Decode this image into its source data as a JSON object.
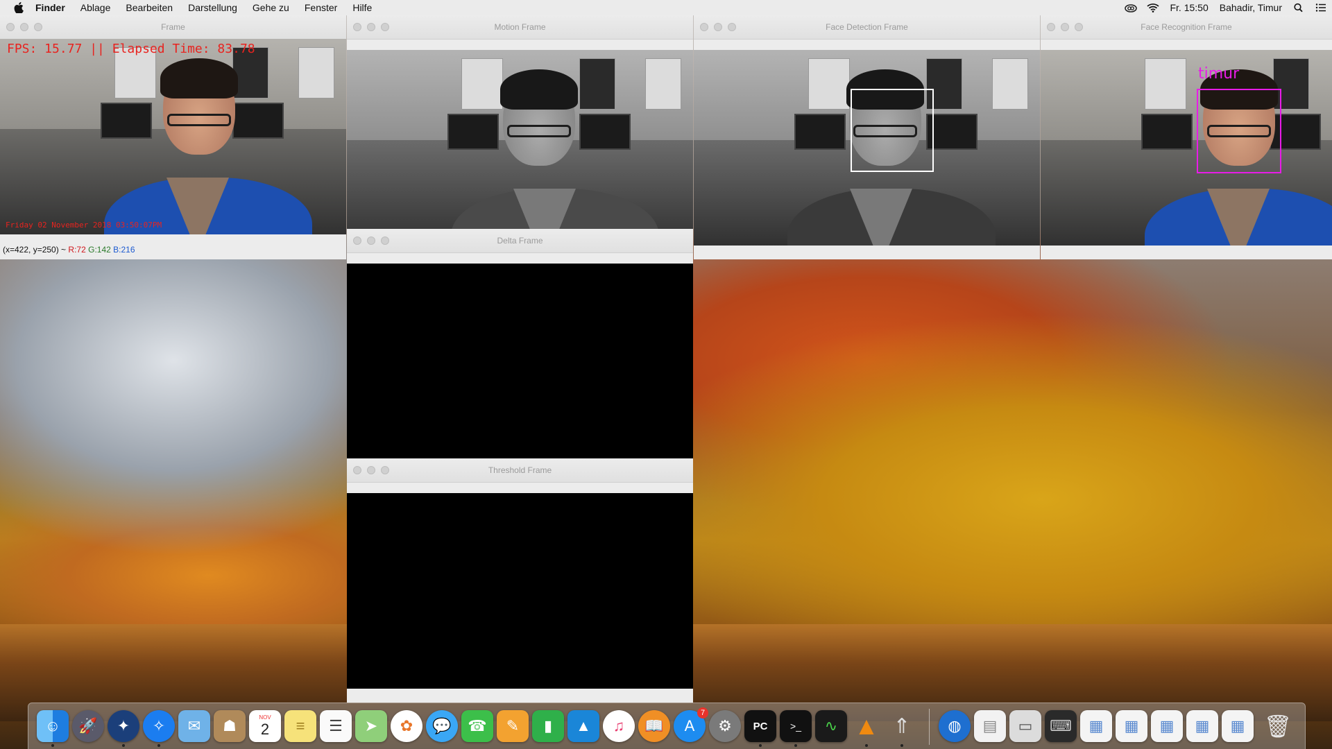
{
  "menubar": {
    "app": "Finder",
    "items": [
      "Ablage",
      "Bearbeiten",
      "Darstellung",
      "Gehe zu",
      "Fenster",
      "Hilfe"
    ],
    "clock": "Fr. 15:50",
    "user": "Bahadir, Timur"
  },
  "windows": {
    "frame": {
      "title": "Frame",
      "fps_text": "FPS: 15.77 || Elapsed Time: 83.78",
      "date_text": "Friday 02 November 2018 03:50:07PM",
      "status": {
        "coords": "(x=422, y=250) ~ ",
        "r": "R:72",
        "g": "G:142",
        "b": "B:216"
      }
    },
    "motion": {
      "title": "Motion Frame"
    },
    "face_detection": {
      "title": "Face Detection Frame"
    },
    "face_recognition": {
      "title": "Face Recognition Frame",
      "label": "timur"
    },
    "delta": {
      "title": "Delta Frame"
    },
    "threshold": {
      "title": "Threshold Frame"
    }
  },
  "colors": {
    "overlay_red": "#e8231f",
    "recognition_magenta": "#e81ce8",
    "status_red": "#d0161b",
    "status_green": "#2a7a2a",
    "status_blue": "#1c5ad0"
  },
  "dock": {
    "calendar_month": "NOV",
    "calendar_day": "2",
    "appstore_badge": "7",
    "apps": [
      "finder-icon",
      "launchpad-icon",
      "compass-icon",
      "safari-icon",
      "mail-icon",
      "contacts-icon",
      "calendar-icon",
      "notes-icon",
      "reminders-icon",
      "maps-icon",
      "photos-icon",
      "messages-icon",
      "facetime-icon",
      "pages-icon",
      "numbers-icon",
      "keynote-icon",
      "itunes-icon",
      "ibooks-icon",
      "appstore-icon",
      "system-preferences-icon",
      "pycharm-icon",
      "terminal-icon",
      "activity-monitor-icon",
      "vlc-icon",
      "rocket-icon",
      "globe-icon",
      "document-icon",
      "scanner-icon",
      "keyboard-icon",
      "screenshot-1-icon",
      "screenshot-2-icon",
      "screenshot-3-icon",
      "screenshot-4-icon",
      "screenshot-5-icon",
      "printer-icon",
      "trash-icon"
    ],
    "pycharm_label": "PC"
  }
}
